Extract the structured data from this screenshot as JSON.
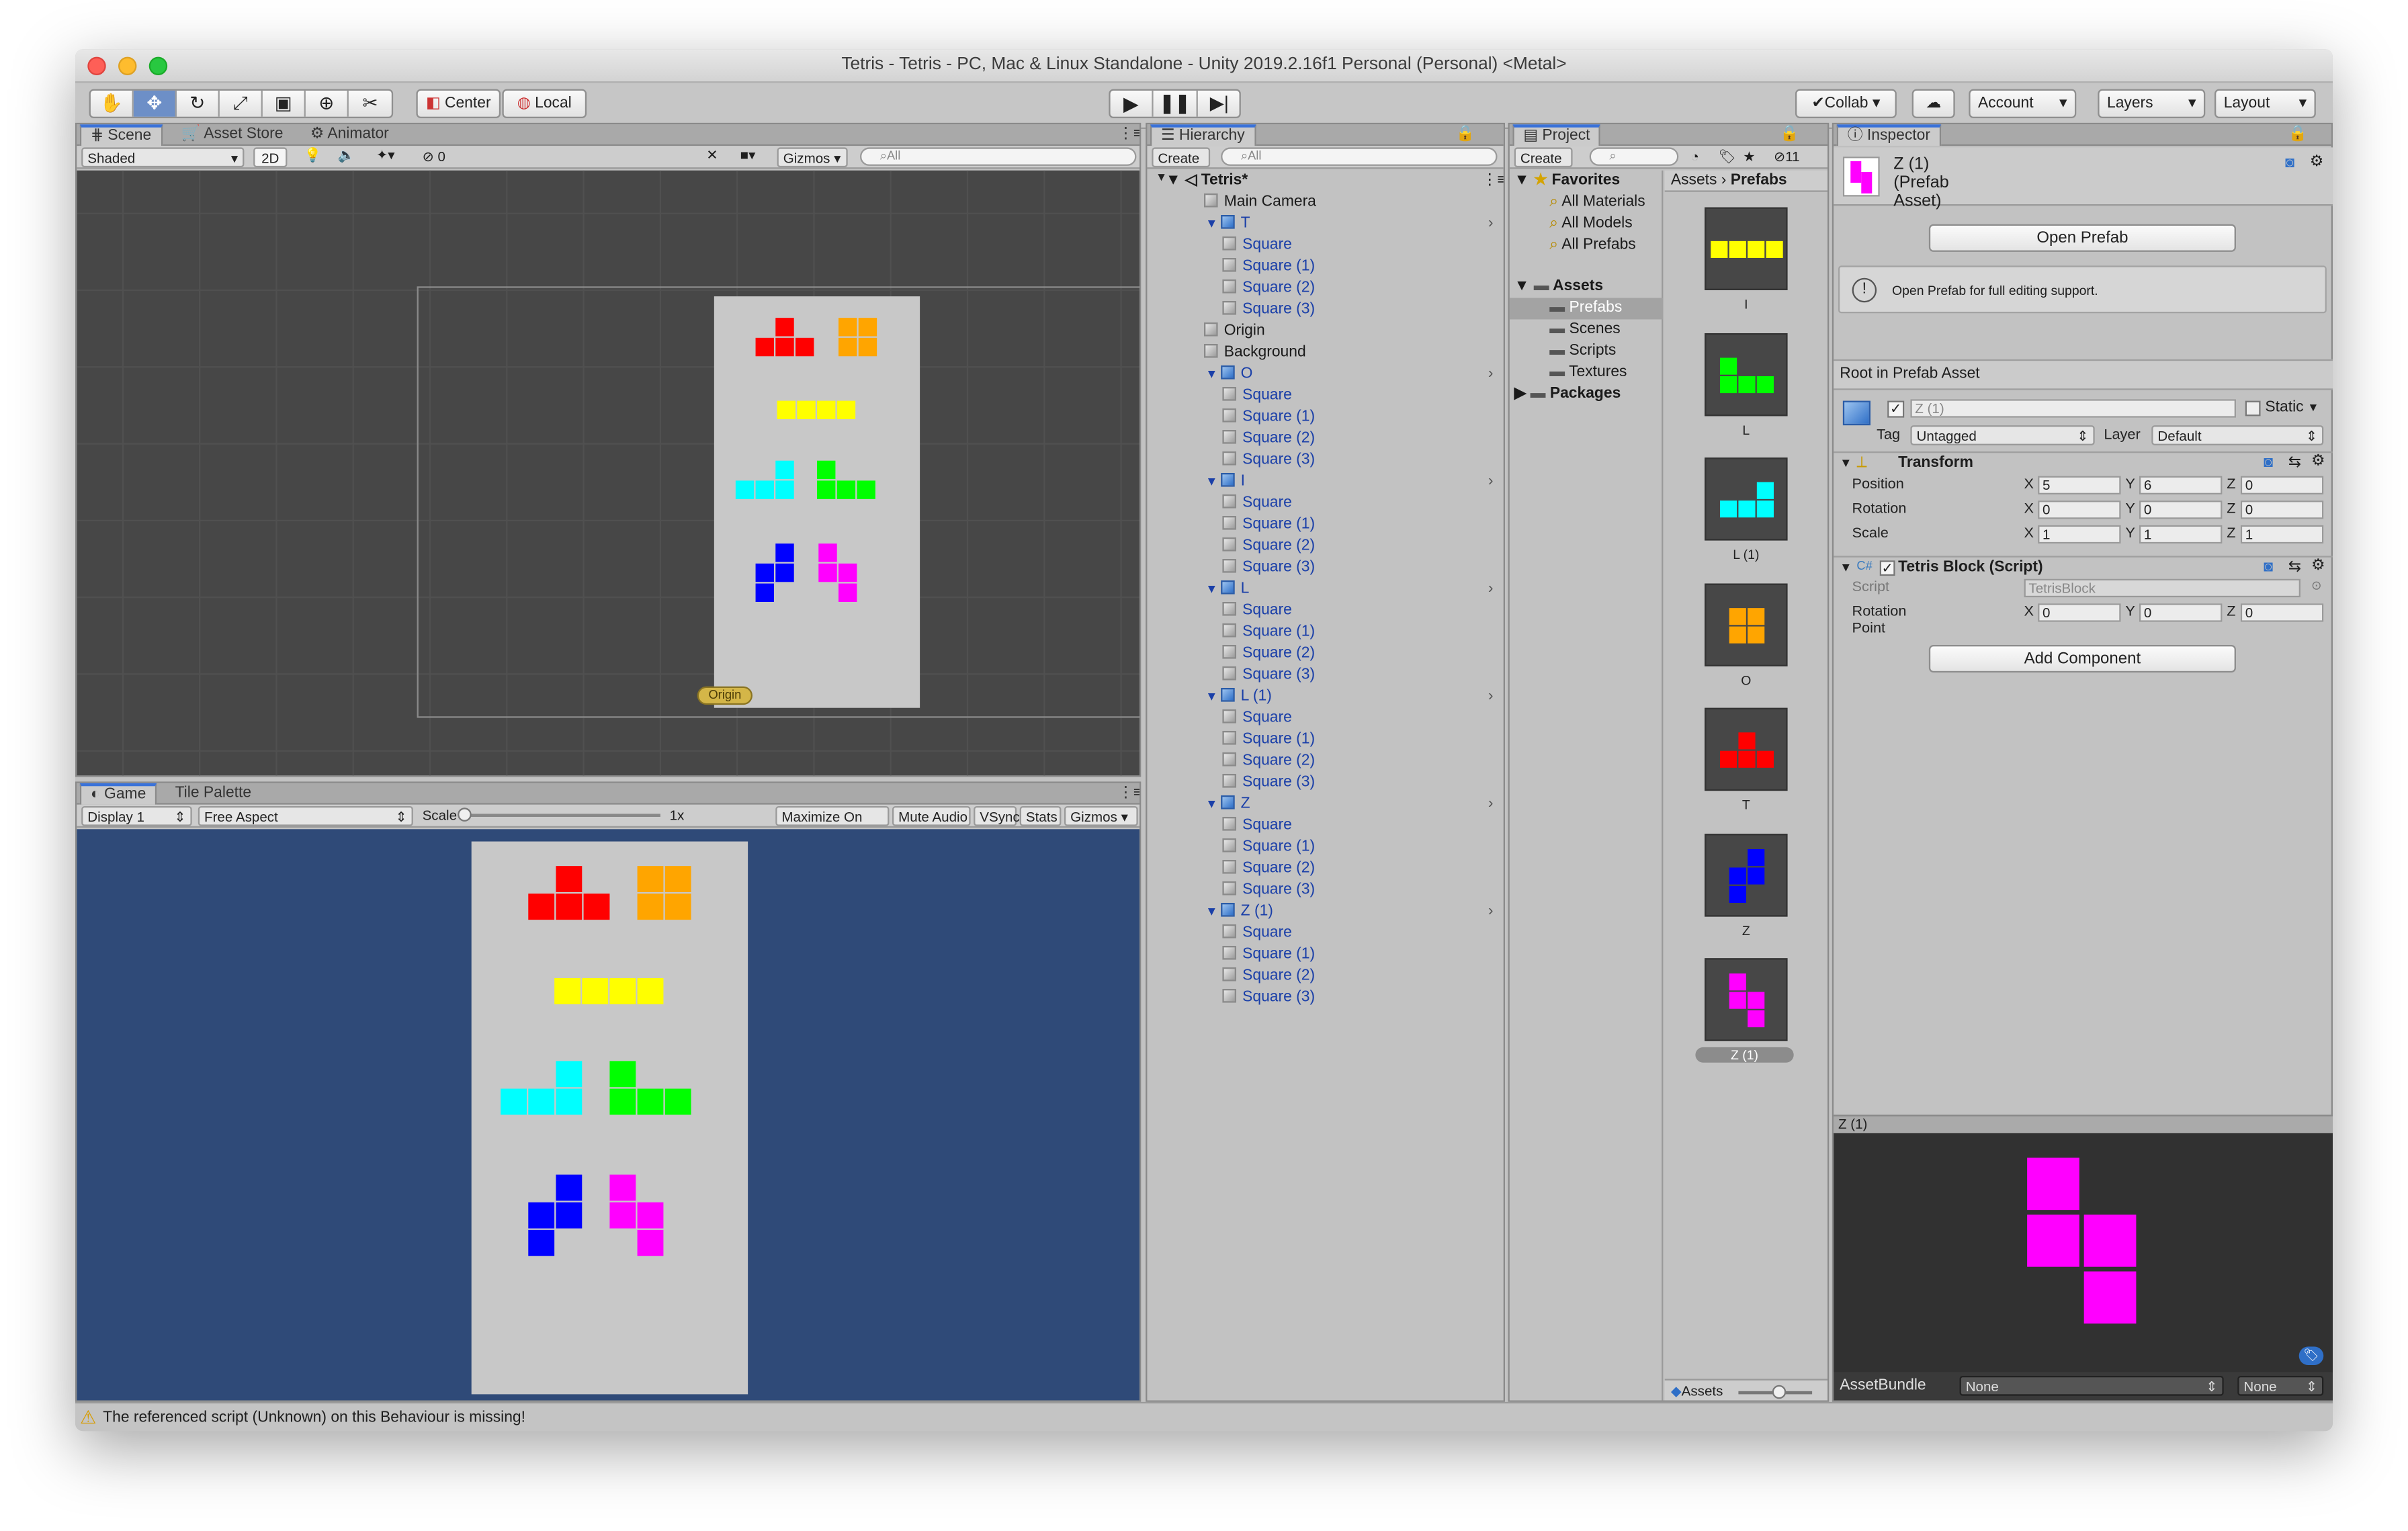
{
  "window": {
    "title": "Tetris - Tetris - PC, Mac & Linux Standalone - Unity 2019.2.16f1 Personal (Personal) <Metal>"
  },
  "toolbar": {
    "tools": [
      "hand-tool-icon",
      "move-tool-icon",
      "rotate-tool-icon",
      "scale-tool-icon",
      "rect-tool-icon",
      "transform-tool-icon",
      "custom-tool-icon"
    ],
    "center_label": "Center",
    "local_label": "Local",
    "collab_label": "Collab",
    "account_label": "Account",
    "layers_label": "Layers",
    "layout_label": "Layout"
  },
  "scene": {
    "tabs": [
      "Scene",
      "Asset Store",
      "Animator"
    ],
    "shading": "Shaded",
    "mode_2d": "2D",
    "hidden_count": "0",
    "gizmos": "Gizmos",
    "search_placeholder": "All",
    "origin_label": "Origin"
  },
  "game": {
    "tabs": [
      "Game",
      "Tile Palette"
    ],
    "display": "Display 1",
    "aspect": "Free Aspect",
    "scale_label": "Scale",
    "scale_value": "1x",
    "maximize": "Maximize On Play",
    "mute": "Mute Audio",
    "vsync": "VSync",
    "stats": "Stats",
    "gizmos": "Gizmos"
  },
  "hierarchy": {
    "tab": "Hierarchy",
    "create": "Create",
    "search_placeholder": "All",
    "scene_name": "Tetris*",
    "rows": [
      {
        "label": "Main Camera",
        "blue": false,
        "prefab": false
      },
      {
        "label": "T",
        "blue": true,
        "prefab": true
      },
      {
        "label": "Square",
        "blue": true,
        "prefab": false
      },
      {
        "label": "Square (1)",
        "blue": true,
        "prefab": false
      },
      {
        "label": "Square (2)",
        "blue": true,
        "prefab": false
      },
      {
        "label": "Square (3)",
        "blue": true,
        "prefab": false
      },
      {
        "label": "Origin",
        "blue": false,
        "prefab": false
      },
      {
        "label": "Background",
        "blue": false,
        "prefab": false
      },
      {
        "label": "O",
        "blue": true,
        "prefab": true
      },
      {
        "label": "Square",
        "blue": true,
        "prefab": false
      },
      {
        "label": "Square (1)",
        "blue": true,
        "prefab": false
      },
      {
        "label": "Square (2)",
        "blue": true,
        "prefab": false
      },
      {
        "label": "Square (3)",
        "blue": true,
        "prefab": false
      },
      {
        "label": "I",
        "blue": true,
        "prefab": true
      },
      {
        "label": "Square",
        "blue": true,
        "prefab": false
      },
      {
        "label": "Square (1)",
        "blue": true,
        "prefab": false
      },
      {
        "label": "Square (2)",
        "blue": true,
        "prefab": false
      },
      {
        "label": "Square (3)",
        "blue": true,
        "prefab": false
      },
      {
        "label": "L",
        "blue": true,
        "prefab": true
      },
      {
        "label": "Square",
        "blue": true,
        "prefab": false
      },
      {
        "label": "Square (1)",
        "blue": true,
        "prefab": false
      },
      {
        "label": "Square (2)",
        "blue": true,
        "prefab": false
      },
      {
        "label": "Square (3)",
        "blue": true,
        "prefab": false
      },
      {
        "label": "L (1)",
        "blue": true,
        "prefab": true
      },
      {
        "label": "Square",
        "blue": true,
        "prefab": false
      },
      {
        "label": "Square (1)",
        "blue": true,
        "prefab": false
      },
      {
        "label": "Square (2)",
        "blue": true,
        "prefab": false
      },
      {
        "label": "Square (3)",
        "blue": true,
        "prefab": false
      },
      {
        "label": "Z",
        "blue": true,
        "prefab": true
      },
      {
        "label": "Square",
        "blue": true,
        "prefab": false
      },
      {
        "label": "Square (1)",
        "blue": true,
        "prefab": false
      },
      {
        "label": "Square (2)",
        "blue": true,
        "prefab": false
      },
      {
        "label": "Square (3)",
        "blue": true,
        "prefab": false
      },
      {
        "label": "Z (1)",
        "blue": true,
        "prefab": true
      },
      {
        "label": "Square",
        "blue": true,
        "prefab": false
      },
      {
        "label": "Square (1)",
        "blue": true,
        "prefab": false
      },
      {
        "label": "Square (2)",
        "blue": true,
        "prefab": false
      },
      {
        "label": "Square (3)",
        "blue": true,
        "prefab": false
      }
    ]
  },
  "project": {
    "tab": "Project",
    "create": "Create",
    "hidden_count": "11",
    "favorites": {
      "label": "Favorites",
      "items": [
        "All Materials",
        "All Models",
        "All Prefabs"
      ]
    },
    "assets": {
      "label": "Assets",
      "items": [
        "Prefabs",
        "Scenes",
        "Scripts",
        "Textures"
      ]
    },
    "packages": "Packages",
    "breadcrumb": [
      "Assets",
      "Prefabs"
    ],
    "prefabs": [
      {
        "label": "I",
        "color": "#ffff00"
      },
      {
        "label": "L",
        "color": "#00ff00"
      },
      {
        "label": "L (1)",
        "color": "#00ffff"
      },
      {
        "label": "O",
        "color": "#ffa500"
      },
      {
        "label": "T",
        "color": "#ff0000"
      },
      {
        "label": "Z",
        "color": "#0000ff"
      },
      {
        "label": "Z (1)",
        "color": "#ff00ff"
      }
    ],
    "footer": "Assets"
  },
  "inspector": {
    "tab": "Inspector",
    "asset_title": "Z (1) (Prefab Asset)",
    "open_prefab": "Open Prefab",
    "info": "Open Prefab for full editing support.",
    "root_label": "Root in Prefab Asset",
    "object_name": "Z (1)",
    "static_label": "Static",
    "tag_label": "Tag",
    "tag_value": "Untagged",
    "layer_label": "Layer",
    "layer_value": "Default",
    "transform": {
      "title": "Transform",
      "position_label": "Position",
      "position": [
        "5",
        "6",
        "0"
      ],
      "rotation_label": "Rotation",
      "rotation": [
        "0",
        "0",
        "0"
      ],
      "scale_label": "Scale",
      "scale": [
        "1",
        "1",
        "1"
      ]
    },
    "script_component": {
      "title": "Tetris Block (Script)",
      "script_label": "Script",
      "script_value": "TetrisBlock",
      "rotation_point_label": "Rotation Point",
      "rotation_point": [
        "0",
        "0",
        "0"
      ]
    },
    "add_component": "Add Component",
    "preview_title": "Z (1)",
    "assetbundle_label": "AssetBundle",
    "assetbundle_value": "None",
    "assetbundle_variant": "None",
    "axis": [
      "X",
      "Y",
      "Z"
    ]
  },
  "status": {
    "message": "The referenced script (Unknown) on this Behaviour is missing!"
  },
  "colors": {
    "red": "#ff0000",
    "orange": "#ffa500",
    "yellow": "#ffff00",
    "cyan": "#00ffff",
    "green": "#00ff00",
    "blue": "#0000ff",
    "magenta": "#ff00ff",
    "game_bg": "#2f4a78",
    "board_bg": "#c8c8c8",
    "scene_bg": "#474747"
  }
}
